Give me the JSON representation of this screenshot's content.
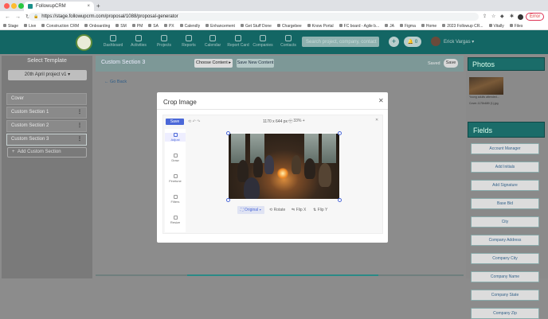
{
  "browser": {
    "tab_title": "FollowupCRM",
    "url": "https://stage.followupcrm.com/proposal/1088/proposal-generator",
    "error_label": "Error",
    "bookmarks": [
      "Stage",
      "Live",
      "Construction CRM",
      "Onboarding",
      "SM",
      "PM",
      "SA",
      "PX",
      "Calendly",
      "Enhancement",
      "Get Stuff Done",
      "Chargebee",
      "Know Portal",
      "FC board - Agile b...",
      "JA",
      "Figma",
      "Home",
      "2023 Followup CR...",
      "Vitally",
      "Files"
    ]
  },
  "nav": {
    "items": [
      "Dashboard",
      "Activities",
      "Projects",
      "Reports",
      "Calendar",
      "Report Card",
      "Companies",
      "Contacts"
    ],
    "search_placeholder": "Search project, company, contact",
    "notif_count": "0",
    "user_name": "Erick Vargas"
  },
  "sidebar": {
    "title": "Select Template",
    "template": "20th April project v1",
    "sections": [
      "Cover",
      "Custom Section 1",
      "Custom Section 2",
      "Custom Section 3"
    ],
    "add_label": "Add Custom Section"
  },
  "content": {
    "title": "Custom Section 3",
    "choose_label": "Choose Content",
    "save_new_label": "Save New Content",
    "saved_label": "Saved",
    "save_label": "Save",
    "go_back": "Go Back"
  },
  "photos": {
    "heading": "Photos",
    "cap1": "Young adults attended...",
    "cap2": "Cover-1178x689 (1).jpg"
  },
  "fields": {
    "heading": "Fields",
    "items": [
      "Account Manager",
      "Add Initials",
      "Add Signature",
      "Base Bid",
      "City",
      "Company Address",
      "Company City",
      "Company Name",
      "Company State",
      "Company Zip"
    ]
  },
  "modal": {
    "title": "Crop Image",
    "save_label": "Save",
    "dimensions": "1170 x 644 px",
    "zoom": "33%",
    "tools": [
      "Adjust",
      "Draw",
      "Finetune",
      "Filters",
      "Resize"
    ],
    "crop_preset": "Original",
    "rotate_label": "Rotate",
    "flipx_label": "Flip X",
    "flipy_label": "Flip Y"
  },
  "colors": {
    "teal": "#136664",
    "accent": "#4b68d8"
  }
}
